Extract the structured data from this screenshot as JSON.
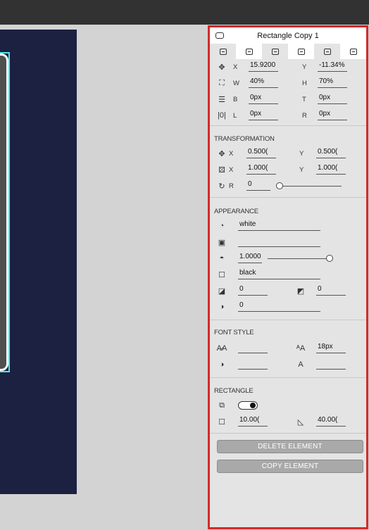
{
  "panel": {
    "title": "Rectangle Copy 1",
    "position": {
      "x_label": "X",
      "x_value": "15.9200",
      "y_label": "Y",
      "y_value": "-11.34%",
      "w_label": "W",
      "w_value": "40%",
      "h_label": "H",
      "h_value": "70%",
      "b_label": "B",
      "b_value": "0px",
      "t_label": "T",
      "t_value": "0px",
      "l_label": "L",
      "l_value": "0px",
      "r_label": "R",
      "r_value": "0px"
    },
    "transformation": {
      "title": "TRANSFORMATION",
      "tx_label": "X",
      "tx_value": "0.500(",
      "ty_label": "Y",
      "ty_value": "0.500(",
      "sx_label": "X",
      "sx_value": "1.000(",
      "sy_label": "Y",
      "sy_value": "1.000(",
      "r_label": "R",
      "r_value": "0"
    },
    "appearance": {
      "title": "APPEARANCE",
      "fill_color": "white",
      "image_value": "",
      "opacity": "1.0000",
      "border_color": "black",
      "shadow_1": "0",
      "shadow_2": "0",
      "blur": "0"
    },
    "font_style": {
      "title": "FONT STYLE",
      "font_family_value": "",
      "font_size_value": "18px",
      "font_color_value": "",
      "font_weight_value": ""
    },
    "rectangle": {
      "title": "RECTANGLE",
      "toggle_on": true,
      "radius_value": "10.00(",
      "corner_value": "40.00("
    },
    "buttons": {
      "delete": "DELETE ELEMENT",
      "copy": "COPY ELEMENT"
    }
  },
  "colors": {
    "panel_border": "#d22a2a",
    "artboard": "#1c2041",
    "selection": "#4de8e8",
    "button": "#a9a9a9"
  }
}
